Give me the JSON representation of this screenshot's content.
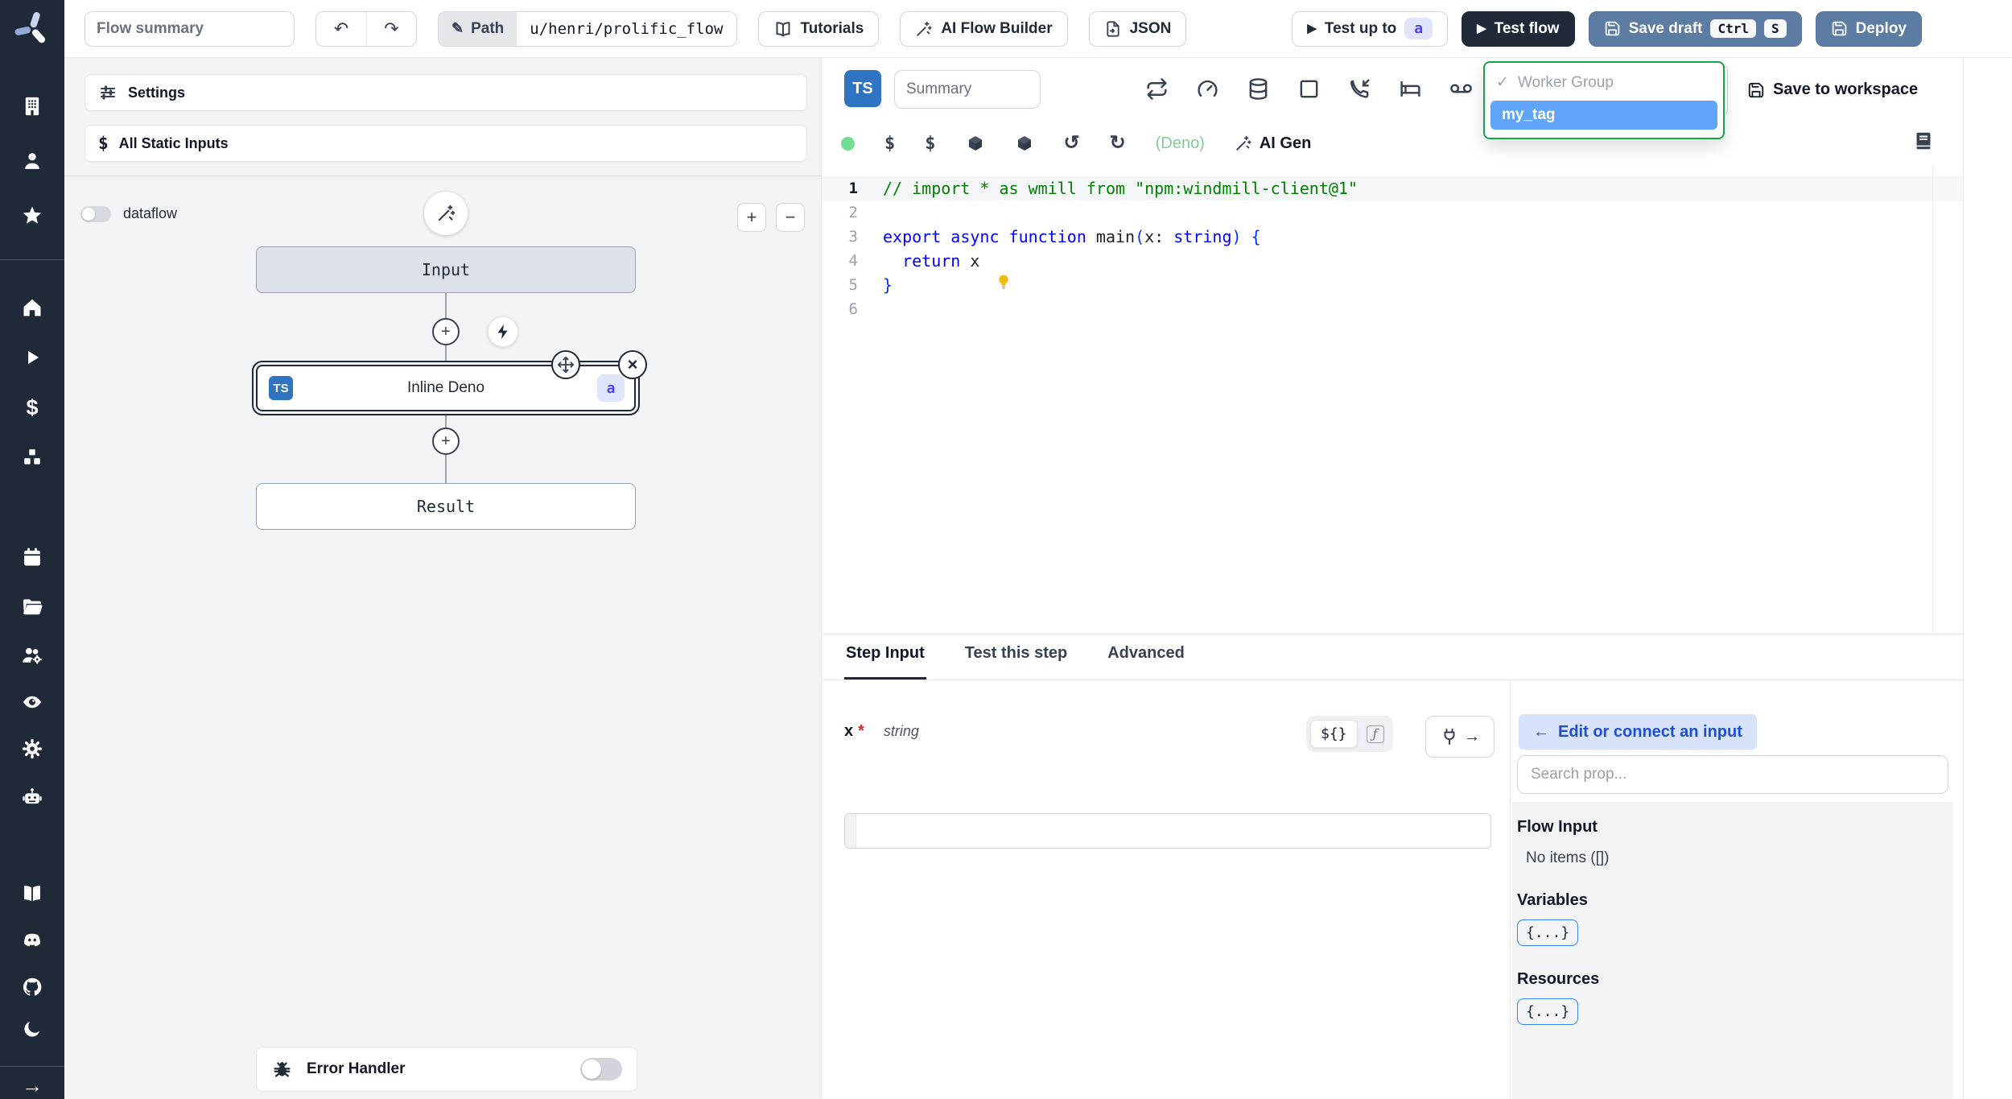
{
  "topbar": {
    "flow_summary_placeholder": "Flow summary",
    "path_label": "Path",
    "path_value": "u/henri/prolific_flow",
    "tutorials": "Tutorials",
    "ai_flow_builder": "AI Flow Builder",
    "json": "JSON",
    "test_up_to": "Test up to",
    "test_up_to_badge": "a",
    "test_flow": "Test flow",
    "save_draft": "Save draft",
    "kbd_ctrl": "Ctrl",
    "kbd_s": "S",
    "deploy": "Deploy"
  },
  "flow_panel": {
    "settings": "Settings",
    "all_static_inputs": "All Static Inputs",
    "dataflow_label": "dataflow",
    "nodes": {
      "input": "Input",
      "step_label": "Inline Deno",
      "step_lang_badge": "TS",
      "step_id_badge": "a",
      "result": "Result"
    },
    "error_handler": "Error Handler"
  },
  "editor": {
    "lang_badge": "TS",
    "summary_placeholder": "Summary",
    "deno_label": "(Deno)",
    "ai_gen": "AI Gen",
    "save_to_workspace": "Save to workspace",
    "worker_group_dropdown": {
      "group_label": "Worker Group",
      "tag": "my_tag"
    },
    "line_numbers": [
      "1",
      "2",
      "3",
      "4",
      "5",
      "6"
    ],
    "code": {
      "l1": "// import * as wmill from \"npm:windmill-client@1\"",
      "l3_kw": "export async function ",
      "l3_name": "main",
      "l3_open": "(",
      "l3_arg": "x: ",
      "l3_type": "string",
      "l3_close": ") {",
      "l4_indent": "  ",
      "l4_kw": "return",
      "l4_val": " x",
      "l5": "}"
    }
  },
  "bottom": {
    "tabs": [
      {
        "label": "Step Input"
      },
      {
        "label": "Test this step"
      },
      {
        "label": "Advanced"
      }
    ],
    "field": {
      "name": "x",
      "required_mark": "*",
      "type": "string",
      "expr_toggle": "${}",
      "fn_toggle": "ƒ"
    },
    "connect_panel": {
      "edit_or_connect": "Edit or connect an input",
      "search_placeholder": "Search prop...",
      "flow_input_title": "Flow Input",
      "no_items": "No items ([])",
      "variables_title": "Variables",
      "variables_chip": "{...}",
      "resources_title": "Resources",
      "resources_chip": "{...}"
    }
  },
  "icons": {
    "play": "▶",
    "check": "✓",
    "arrow_left": "←",
    "arrow_right": "→",
    "undo": "↶",
    "redo": "↷",
    "pencil": "✎",
    "dollar": "$",
    "history": "↺",
    "refresh": "↻",
    "close": "×",
    "plus": "+",
    "minus": "−"
  },
  "colors": {
    "sidebar_dark": "#1f2937",
    "steel_blue_button": "#5d7ca3",
    "selection_blue": "#60a5fa",
    "worker_group_border_green": "#16a34a",
    "indigo_badge_bg": "#e0e4fc",
    "indigo_badge_text": "#4f46e5",
    "status_green_dot": "#74dd95",
    "deno_green": "#84cc96",
    "ts_blue": "#2f74c0"
  }
}
